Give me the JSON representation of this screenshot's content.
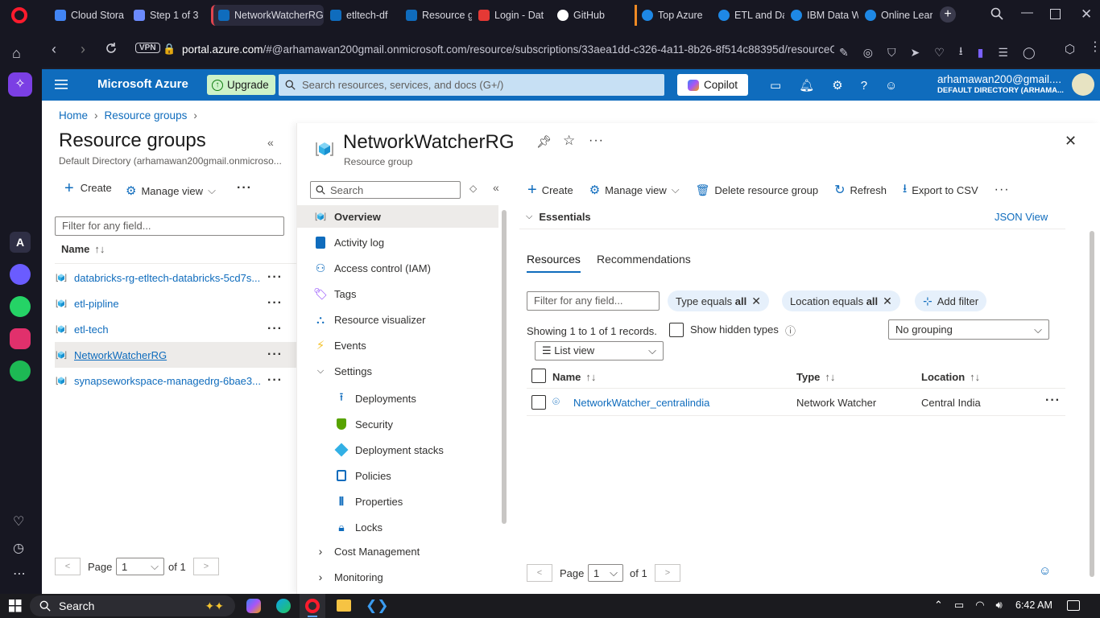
{
  "browser": {
    "tabs": [
      {
        "title": "Cloud Stora",
        "color": "#4285f4"
      },
      {
        "title": "Step 1 of 3",
        "color": "#6b8afd"
      },
      {
        "title": "NetworkWatcherRG",
        "color": "#0f6cbd"
      },
      {
        "title": "etltech-df",
        "color": "#0f6cbd"
      },
      {
        "title": "Resource g",
        "color": "#0f6cbd"
      },
      {
        "title": "Login - Dat",
        "color": "#e53935"
      },
      {
        "title": "GitHub",
        "color": "#ffffff"
      },
      {
        "title": "Top Azure",
        "color": "#1e88e5"
      },
      {
        "title": "ETL and Da",
        "color": "#1e88e5"
      },
      {
        "title": "IBM Data W",
        "color": "#1e88e5"
      },
      {
        "title": "Online Lear",
        "color": "#1e88e5"
      }
    ],
    "vpn": "VPN",
    "url_host": "portal.azure.com",
    "url_rest": "/#@arhamawan200gmail.onmicrosoft.com/resource/subscriptions/33aea1dd-c326-4a11-8b26-8f514c88395d/resourceGro"
  },
  "azure": {
    "brand": "Microsoft Azure",
    "upgrade": "Upgrade",
    "search_placeholder": "Search resources, services, and docs (G+/)",
    "copilot": "Copilot",
    "user_email": "arhamawan200@gmail....",
    "user_dir": "DEFAULT DIRECTORY (ARHAMA..."
  },
  "breadcrumb": {
    "home": "Home",
    "rg": "Resource groups"
  },
  "left": {
    "title": "Resource groups",
    "subtitle": "Default Directory (arhamawan200gmail.onmicroso...",
    "create": "Create",
    "manage_view": "Manage view",
    "filter_placeholder": "Filter for any field...",
    "col_name": "Name",
    "rows": [
      "databricks-rg-etltech-databricks-5cd7s...",
      "etl-pipline",
      "etl-tech",
      "NetworkWatcherRG",
      "synapseworkspace-managedrg-6bae3..."
    ],
    "page_label": "Page",
    "page_value": "1",
    "of": "of 1"
  },
  "rg": {
    "title": "NetworkWatcherRG",
    "subtitle": "Resource group",
    "search_placeholder": "Search",
    "nav": [
      {
        "label": "Overview",
        "icon": "cube-icon"
      },
      {
        "label": "Activity log",
        "icon": "log-icon"
      },
      {
        "label": "Access control (IAM)",
        "icon": "people-icon"
      },
      {
        "label": "Tags",
        "icon": "tag-icon"
      },
      {
        "label": "Resource visualizer",
        "icon": "graph-icon"
      },
      {
        "label": "Events",
        "icon": "lightning-icon"
      }
    ],
    "settings_label": "Settings",
    "settings_items": [
      {
        "label": "Deployments",
        "icon": "upload-icon"
      },
      {
        "label": "Security",
        "icon": "shield-icon"
      },
      {
        "label": "Deployment stacks",
        "icon": "stack-icon"
      },
      {
        "label": "Policies",
        "icon": "policy-icon"
      },
      {
        "label": "Properties",
        "icon": "bars-icon"
      },
      {
        "label": "Locks",
        "icon": "lock-icon"
      }
    ],
    "cost": "Cost Management",
    "monitoring": "Monitoring"
  },
  "toolbar": {
    "create": "Create",
    "manage_view": "Manage view",
    "delete": "Delete resource group",
    "refresh": "Refresh",
    "export": "Export to CSV"
  },
  "essentials": {
    "label": "Essentials",
    "json_view": "JSON View"
  },
  "tabs": {
    "resources": "Resources",
    "recommendations": "Recommendations"
  },
  "filters": {
    "placeholder": "Filter for any field...",
    "type_chip": "Type equals",
    "type_value": "all",
    "location_chip": "Location equals",
    "location_value": "all",
    "add_filter": "Add filter"
  },
  "records": {
    "showing": "Showing 1 to 1 of 1 records.",
    "show_hidden": "Show hidden types",
    "grouping": "No grouping",
    "list_view": "List view"
  },
  "table": {
    "headers": {
      "name": "Name",
      "type": "Type",
      "location": "Location"
    },
    "rows": [
      {
        "name": "NetworkWatcher_centralindia",
        "type": "Network Watcher",
        "location": "Central India"
      }
    ]
  },
  "main_pager": {
    "page_label": "Page",
    "page_value": "1",
    "of": "of 1"
  },
  "taskbar": {
    "search": "Search",
    "time": "6:42 AM"
  }
}
